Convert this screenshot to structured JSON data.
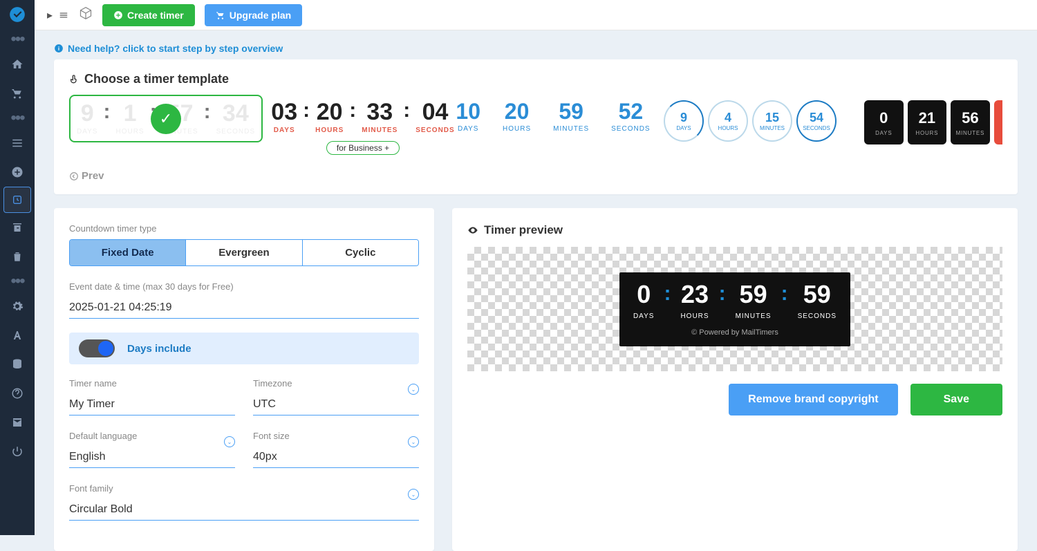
{
  "topbar": {
    "create_timer_label": "Create timer",
    "upgrade_plan_label": "Upgrade plan"
  },
  "help_link": "Need help? click to start step by step overview",
  "section_title": "Choose a timer template",
  "templates": {
    "t1": {
      "days": "9",
      "hours": "1",
      "minutes": "57",
      "seconds": "34",
      "days_lbl": "DAYS",
      "hours_lbl": "HOURS",
      "minutes_lbl": "MINUTES",
      "seconds_lbl": "SECONDS"
    },
    "t2": {
      "days": "03",
      "hours": "20",
      "minutes": "33",
      "seconds": "04",
      "days_lbl": "DAYS",
      "hours_lbl": "HOURS",
      "minutes_lbl": "MINUTES",
      "seconds_lbl": "SECONDS",
      "badge": "for Business +"
    },
    "t3": {
      "days": "10",
      "hours": "20",
      "minutes": "59",
      "seconds": "52",
      "days_lbl": "DAYS",
      "hours_lbl": "HOURS",
      "minutes_lbl": "MINUTES",
      "seconds_lbl": "SECONDS"
    },
    "t4": {
      "days": "9",
      "hours": "4",
      "minutes": "15",
      "seconds": "54",
      "days_lbl": "DAYS",
      "hours_lbl": "HOURS",
      "minutes_lbl": "MINUTES",
      "seconds_lbl": "SECONDS"
    },
    "t5": {
      "days": "0",
      "hours": "21",
      "minutes": "56",
      "days_lbl": "DAYS",
      "hours_lbl": "HOURS",
      "minutes_lbl": "MINUTES"
    }
  },
  "prev_label": "Prev",
  "form": {
    "type_label": "Countdown timer type",
    "tab_fixed": "Fixed Date",
    "tab_evergreen": "Evergreen",
    "tab_cyclic": "Cyclic",
    "event_label": "Event date & time (max 30 days for Free)",
    "event_value": "2025-01-21 04:25:19",
    "days_include_label": "Days include",
    "timer_name_label": "Timer name",
    "timer_name_value": "My Timer",
    "timezone_label": "Timezone",
    "timezone_value": "UTC",
    "language_label": "Default language",
    "language_value": "English",
    "fontsize_label": "Font size",
    "fontsize_value": "40px",
    "fontfamily_label": "Font family",
    "fontfamily_value": "Circular Bold"
  },
  "preview": {
    "title": "Timer preview",
    "days": "0",
    "hours": "23",
    "minutes": "59",
    "seconds": "59",
    "days_lbl": "DAYS",
    "hours_lbl": "HOURS",
    "minutes_lbl": "MINUTES",
    "seconds_lbl": "SECONDS",
    "powered": "© Powered by MailTimers",
    "remove_brand_label": "Remove brand copyright",
    "save_label": "Save"
  }
}
